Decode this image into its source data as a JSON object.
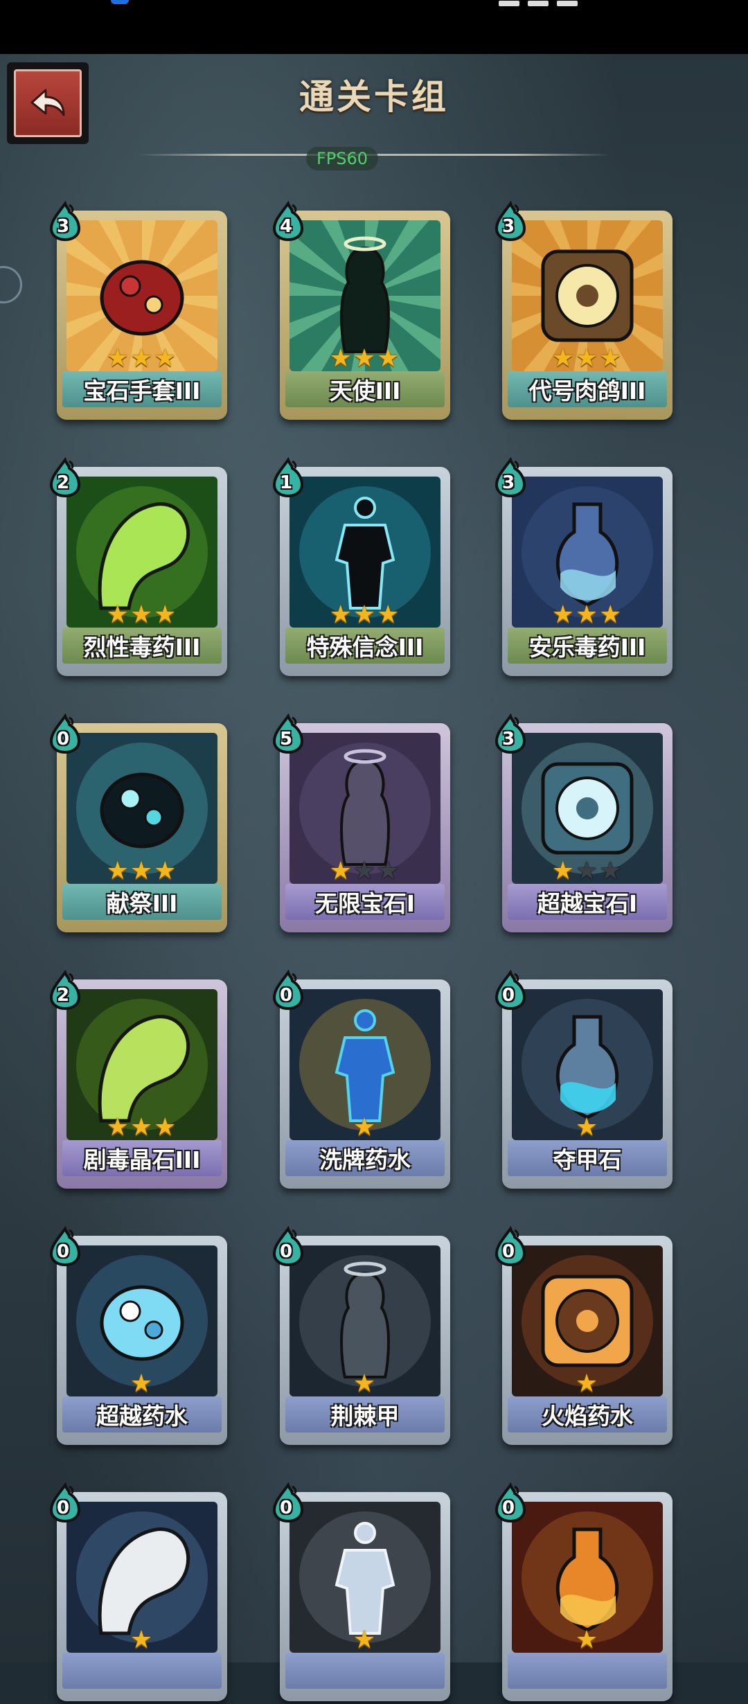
{
  "header": {
    "title": "通关卡组",
    "fps": "FPS60"
  },
  "icons": {
    "back": "back-arrow-icon",
    "cost": "mana-droplet-icon",
    "star": "star-icon"
  },
  "colors": {
    "star_on": "#f5b51d",
    "star_off": "#3b3f46",
    "cost_badge": "#37b3a4",
    "back_button": "#a33a32"
  },
  "cards": [
    {
      "name": "宝石手套III",
      "cost": "3",
      "stars": 3,
      "max_stars": 3,
      "art": "gem-gauntlet-icon"
    },
    {
      "name": "天使III",
      "cost": "4",
      "stars": 3,
      "max_stars": 3,
      "art": "angel-icon"
    },
    {
      "name": "代号肉鸽III",
      "cost": "3",
      "stars": 3,
      "max_stars": 3,
      "art": "codename-roguelike-icon"
    },
    {
      "name": "烈性毒药III",
      "cost": "2",
      "stars": 3,
      "max_stars": 3,
      "art": "strong-poison-icon"
    },
    {
      "name": "特殊信念III",
      "cost": "1",
      "stars": 3,
      "max_stars": 3,
      "art": "special-faith-icon"
    },
    {
      "name": "安乐毒药III",
      "cost": "3",
      "stars": 3,
      "max_stars": 3,
      "art": "euthanasia-poison-icon"
    },
    {
      "name": "献祭III",
      "cost": "0",
      "stars": 3,
      "max_stars": 3,
      "art": "sacrifice-icon"
    },
    {
      "name": "无限宝石I",
      "cost": "5",
      "stars": 1,
      "max_stars": 3,
      "art": "infinity-gem-icon"
    },
    {
      "name": "超越宝石I",
      "cost": "3",
      "stars": 1,
      "max_stars": 3,
      "art": "transcend-gem-icon"
    },
    {
      "name": "剧毒晶石III",
      "cost": "2",
      "stars": 3,
      "max_stars": 3,
      "art": "toxic-crystal-icon"
    },
    {
      "name": "洗牌药水",
      "cost": "0",
      "stars": 1,
      "max_stars": 1,
      "art": "shuffle-potion-icon"
    },
    {
      "name": "夺甲石",
      "cost": "0",
      "stars": 1,
      "max_stars": 1,
      "art": "armor-steal-stone-icon"
    },
    {
      "name": "超越药水",
      "cost": "0",
      "stars": 1,
      "max_stars": 1,
      "art": "transcend-potion-icon"
    },
    {
      "name": "荆棘甲",
      "cost": "0",
      "stars": 1,
      "max_stars": 1,
      "art": "thorn-armor-icon"
    },
    {
      "name": "火焰药水",
      "cost": "0",
      "stars": 1,
      "max_stars": 1,
      "art": "fire-potion-icon"
    },
    {
      "name": "",
      "cost": "0",
      "stars": 1,
      "max_stars": 1,
      "art": "ice-potion-icon"
    },
    {
      "name": "",
      "cost": "0",
      "stars": 1,
      "max_stars": 1,
      "art": "rune-scroll-icon"
    },
    {
      "name": "",
      "cost": "0",
      "stars": 1,
      "max_stars": 1,
      "art": "lava-bottle-icon"
    }
  ]
}
